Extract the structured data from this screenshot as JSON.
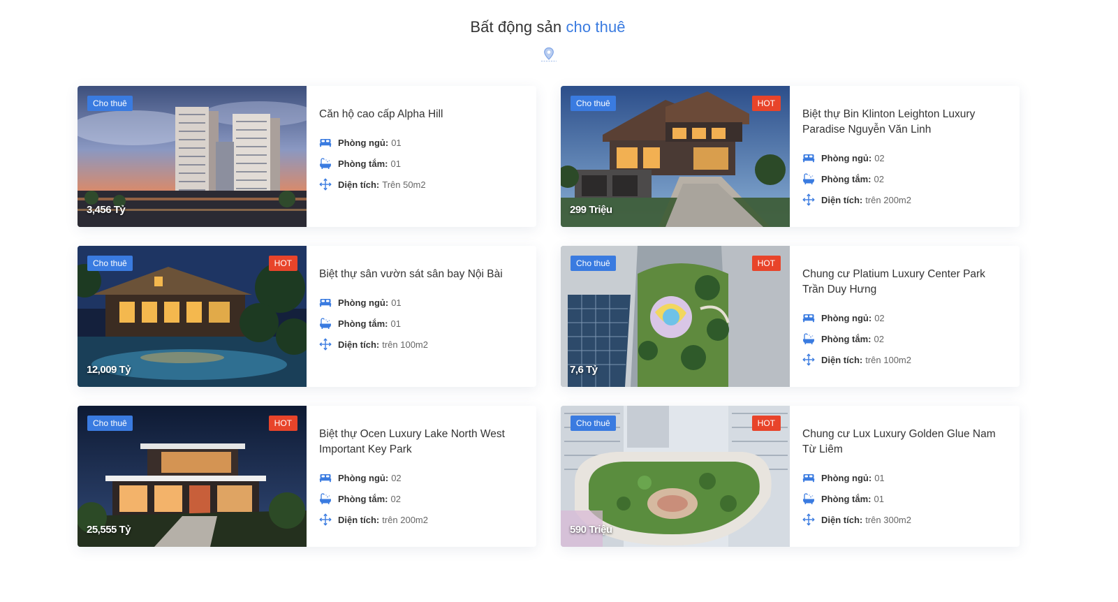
{
  "section": {
    "title_main": "Bất động sản",
    "title_accent": "cho thuê",
    "icon": "map-pin-icon",
    "accent_color": "#3a7be0"
  },
  "labels": {
    "bedroom": "Phòng ngủ:",
    "bathroom": "Phòng tắm:",
    "area": "Diện tích:"
  },
  "listings": [
    {
      "badge": "Cho thuê",
      "hot": "",
      "price": "3,456 Tỷ",
      "name": "Căn hộ cao cấp Alpha Hill",
      "bedrooms": "01",
      "bathrooms": "01",
      "area": "Trên 50m2",
      "scene": "tower"
    },
    {
      "badge": "Cho thuê",
      "hot": "HOT",
      "price": "299 Triệu",
      "name": "Biệt thự Bin Klinton Leighton Luxury Paradise Nguyễn Văn Linh",
      "bedrooms": "02",
      "bathrooms": "02",
      "area": "trên 200m2",
      "scene": "villa"
    },
    {
      "badge": "Cho thuê",
      "hot": "HOT",
      "price": "12,009 Tỷ",
      "name": "Biệt thự sân vườn sát sân bay Nội Bài",
      "bedrooms": "01",
      "bathrooms": "01",
      "area": "trên 100m2",
      "scene": "resort"
    },
    {
      "badge": "Cho thuê",
      "hot": "HOT",
      "price": "7,6 Tỷ",
      "name": "Chung cư Platium Luxury Center Park Trần Duy Hưng",
      "bedrooms": "02",
      "bathrooms": "02",
      "area": "trên 100m2",
      "scene": "garden"
    },
    {
      "badge": "Cho thuê",
      "hot": "HOT",
      "price": "25,555 Tỷ",
      "name": "Biệt thự Ocen Luxury Lake North West Important Key Park",
      "bedrooms": "02",
      "bathrooms": "02",
      "area": "trên 200m2",
      "scene": "modern"
    },
    {
      "badge": "Cho thuê",
      "hot": "HOT",
      "price": "590 Triệu",
      "name": "Chung cư Lux Luxury Golden Glue Nam Từ Liêm",
      "bedrooms": "01",
      "bathrooms": "01",
      "area": "trên 300m2",
      "scene": "rooftop"
    }
  ]
}
